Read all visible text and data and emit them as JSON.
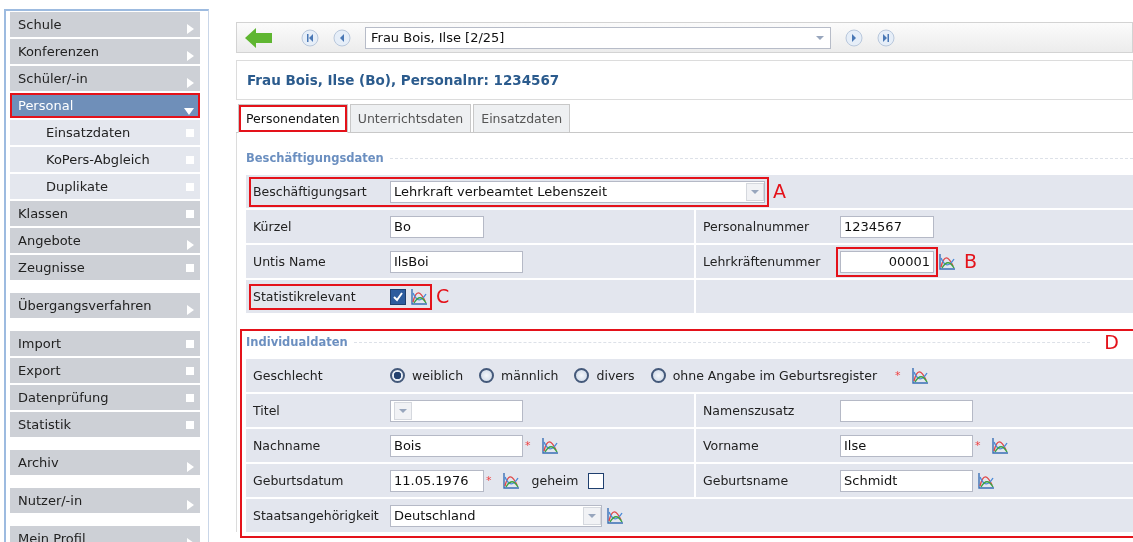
{
  "sidebar": {
    "groups": [
      {
        "items": [
          {
            "label": "Schule",
            "kind": "menu",
            "selected": false,
            "highlighted": false
          },
          {
            "label": "Konferenzen",
            "kind": "menu",
            "selected": false,
            "highlighted": false
          },
          {
            "label": "Schüler/-in",
            "kind": "menu",
            "selected": false,
            "highlighted": false
          },
          {
            "label": "Personal",
            "kind": "open",
            "selected": true,
            "highlighted": true,
            "children": [
              {
                "label": "Einsatzdaten",
                "kind": "page",
                "selected": false
              },
              {
                "label": "KoPers-Abgleich",
                "kind": "page",
                "selected": false
              },
              {
                "label": "Duplikate",
                "kind": "page",
                "selected": false
              }
            ]
          },
          {
            "label": "Klassen",
            "kind": "page",
            "selected": false,
            "highlighted": false
          },
          {
            "label": "Angebote",
            "kind": "menu",
            "selected": false,
            "highlighted": false
          },
          {
            "label": "Zeugnisse",
            "kind": "page",
            "selected": false,
            "highlighted": false
          }
        ]
      },
      {
        "items": [
          {
            "label": "Übergangsverfahren",
            "kind": "menu",
            "selected": false,
            "highlighted": false
          }
        ]
      },
      {
        "items": [
          {
            "label": "Import",
            "kind": "page",
            "selected": false,
            "highlighted": false
          },
          {
            "label": "Export",
            "kind": "page",
            "selected": false,
            "highlighted": false
          },
          {
            "label": "Datenprüfung",
            "kind": "page",
            "selected": false,
            "highlighted": false
          },
          {
            "label": "Statistik",
            "kind": "page",
            "selected": false,
            "highlighted": false
          }
        ]
      },
      {
        "items": [
          {
            "label": "Archiv",
            "kind": "menu",
            "selected": false,
            "highlighted": false
          }
        ]
      },
      {
        "items": [
          {
            "label": "Nutzer/-in",
            "kind": "menu",
            "selected": false,
            "highlighted": false
          }
        ]
      },
      {
        "items": [
          {
            "label": "Mein Profil",
            "kind": "menu",
            "selected": false,
            "highlighted": false
          }
        ]
      }
    ]
  },
  "toolbar": {
    "record": "Frau Bois, Ilse [2/25]"
  },
  "title": "Frau Bois, Ilse (Bo), Personalnr: 1234567",
  "tabs": [
    {
      "label": "Personendaten",
      "selected": true,
      "highlighted": true
    },
    {
      "label": "Unterrichtsdaten",
      "selected": false,
      "highlighted": false
    },
    {
      "label": "Einsatzdaten",
      "selected": false,
      "highlighted": false
    }
  ],
  "sections": [
    {
      "title": "Beschäftigungsdaten",
      "rows": [
        {
          "cells": [
            {
              "kind": "select",
              "label": "Beschäftigungsart",
              "value": "Lehrkraft verbeamtet Lebenszeit",
              "marker": "A"
            }
          ]
        },
        {
          "cells": [
            {
              "kind": "text",
              "label": "Kürzel",
              "value": "Bo"
            },
            {
              "kind": "text",
              "label": "Personalnummer",
              "value": "1234567"
            }
          ]
        },
        {
          "cells": [
            {
              "kind": "text",
              "label": "Untis Name",
              "value": "IlsBoi"
            },
            {
              "kind": "number",
              "label": "Lehrkräftenummer",
              "value": "00001",
              "history": true,
              "marker": "B"
            }
          ]
        },
        {
          "cells": [
            {
              "kind": "checkbox",
              "label": "Statistikrelevant",
              "checked": true,
              "history": true,
              "marker": "C"
            },
            {
              "kind": "empty"
            }
          ]
        }
      ]
    },
    {
      "title": "Individualdaten",
      "marker": "D",
      "rows": [
        {
          "cells": [
            {
              "kind": "radio",
              "label": "Geschlecht",
              "options": [
                {
                  "label": "weiblich",
                  "selected": true
                },
                {
                  "label": "männlich",
                  "selected": false
                },
                {
                  "label": "divers",
                  "selected": false
                },
                {
                  "label": "ohne Angabe im Geburtsregister",
                  "selected": false
                }
              ],
              "required_mark": "*",
              "history": true
            }
          ]
        },
        {
          "cells": [
            {
              "kind": "select",
              "label": "Titel"
            },
            {
              "kind": "text",
              "label": "Namenszusatz"
            }
          ]
        },
        {
          "cells": [
            {
              "kind": "text",
              "label": "Nachname",
              "value": "Bois",
              "required_mark": "*",
              "history": true
            },
            {
              "kind": "text",
              "label": "Vorname",
              "value": "Ilse",
              "required_mark": "*",
              "history": true
            }
          ]
        },
        {
          "cells": [
            {
              "kind": "text",
              "label": "Geburtsdatum",
              "value": "11.05.1976",
              "required_mark": "*",
              "history": true,
              "secret": {
                "label": "geheim",
                "checked": false
              }
            },
            {
              "kind": "text",
              "label": "Geburtsname",
              "value": "Schmidt",
              "history": true
            }
          ]
        },
        {
          "cells": [
            {
              "kind": "select",
              "label": "Staatsangehörigkeit",
              "value": "Deutschland",
              "history": true
            }
          ]
        }
      ]
    }
  ]
}
